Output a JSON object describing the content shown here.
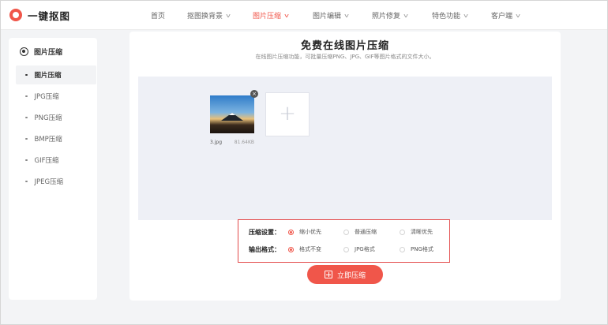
{
  "brand": {
    "name": "一键抠图",
    "color": "#f0564a"
  },
  "nav": {
    "items": [
      {
        "label": "首页",
        "dropdown": false,
        "active": false
      },
      {
        "label": "抠图换背景",
        "dropdown": true,
        "active": false
      },
      {
        "label": "图片压缩",
        "dropdown": true,
        "active": true
      },
      {
        "label": "图片编辑",
        "dropdown": true,
        "active": false
      },
      {
        "label": "照片修复",
        "dropdown": true,
        "active": false
      },
      {
        "label": "特色功能",
        "dropdown": true,
        "active": false
      },
      {
        "label": "客户端",
        "dropdown": true,
        "active": false
      }
    ]
  },
  "sidebar": {
    "heading": "图片压缩",
    "items": [
      {
        "label": "图片压缩",
        "active": true
      },
      {
        "label": "JPG压缩",
        "active": false
      },
      {
        "label": "PNG压缩",
        "active": false
      },
      {
        "label": "BMP压缩",
        "active": false
      },
      {
        "label": "GIF压缩",
        "active": false
      },
      {
        "label": "JPEG压缩",
        "active": false
      }
    ]
  },
  "main": {
    "title": "免费在线图片压缩",
    "subtitle": "在线图片压缩功能，可批量压缩PNG、JPG、GIF等图片格式的文件大小。",
    "upload": {
      "file_name": "3.jpg",
      "file_size": "81.64KB",
      "add_glyph": "+",
      "close_glyph": "×"
    },
    "settings": {
      "compression": {
        "label": "压缩设置：",
        "options": [
          {
            "label": "缩小优先",
            "checked": true
          },
          {
            "label": "普通压缩",
            "checked": false
          },
          {
            "label": "清晰优先",
            "checked": false
          }
        ]
      },
      "output": {
        "label": "输出格式：",
        "options": [
          {
            "label": "格式不变",
            "checked": true
          },
          {
            "label": "JPG格式",
            "checked": false
          },
          {
            "label": "PNG格式",
            "checked": false
          }
        ]
      }
    },
    "compress_button": "立即压缩"
  }
}
